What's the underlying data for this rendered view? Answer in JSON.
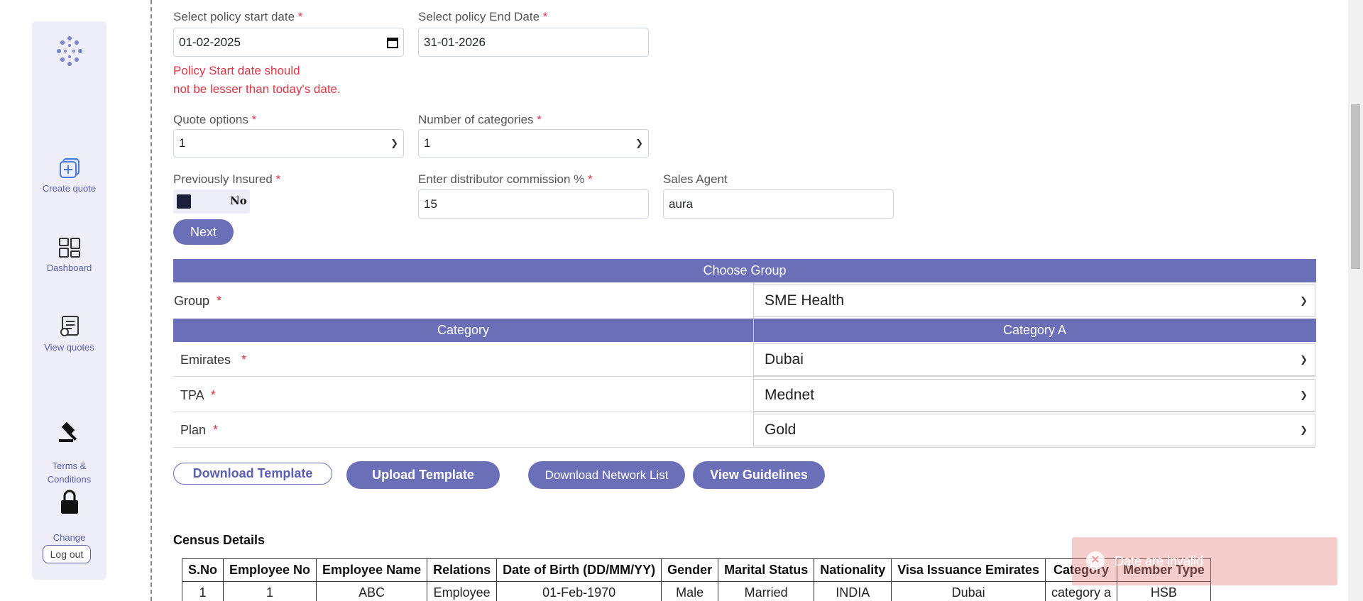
{
  "sidebar": {
    "items": [
      {
        "label": "Create quote",
        "icon": "create-quote-icon"
      },
      {
        "label": "Dashboard",
        "icon": "dashboard-icon"
      },
      {
        "label": "View quotes",
        "icon": "view-quotes-icon"
      },
      {
        "label": "Terms &\nConditions",
        "icon": "gavel-icon"
      },
      {
        "label": "Change\nPassword",
        "icon": "lock-icon"
      }
    ],
    "logout": "Log out"
  },
  "form": {
    "start_date": {
      "label": "Select policy start date",
      "value": "01-02-2025"
    },
    "end_date": {
      "label": "Select policy End Date",
      "value": "31-01-2026"
    },
    "error": "Policy Start date should\nnot be lesser than today's date.",
    "quote_options": {
      "label": "Quote options",
      "value": "1"
    },
    "num_categories": {
      "label": "Number of categories",
      "value": "1"
    },
    "previously_insured": {
      "label": "Previously Insured",
      "value": "No"
    },
    "commission": {
      "label": "Enter distributor commission %",
      "value": "15"
    },
    "sales_agent": {
      "label": "Sales Agent",
      "value": "aura"
    },
    "next": "Next",
    "required_mark": "*"
  },
  "group": {
    "header": "Choose Group",
    "label": "Group",
    "value": "SME Health",
    "category_header": "Category",
    "category_name": "Category A",
    "rows": [
      {
        "label": "Emirates",
        "value": "Dubai"
      },
      {
        "label": "TPA",
        "value": "Mednet"
      },
      {
        "label": "Plan",
        "value": "Gold"
      }
    ]
  },
  "actions": {
    "download_template": "Download Template",
    "upload_template": "Upload Template",
    "download_network": "Download Network List",
    "view_guidelines": "View Guidelines"
  },
  "census": {
    "title": "Census Details",
    "columns": [
      "S.No",
      "Employee No",
      "Employee Name",
      "Relations",
      "Date of Birth (DD/MM/YY)",
      "Gender",
      "Marital Status",
      "Nationality",
      "Visa Issuance Emirates",
      "Category",
      "Member Type"
    ],
    "rows": [
      [
        "1",
        "1",
        "ABC",
        "Employee",
        "01-Feb-1970",
        "Male",
        "Married",
        "INDIA",
        "Dubai",
        "category a",
        "HSB"
      ]
    ]
  },
  "toast": {
    "message": "Date are invalid"
  },
  "colors": {
    "accent": "#6b6fb8",
    "error": "#dc3545",
    "sidebar_bg": "#eeeef8"
  }
}
